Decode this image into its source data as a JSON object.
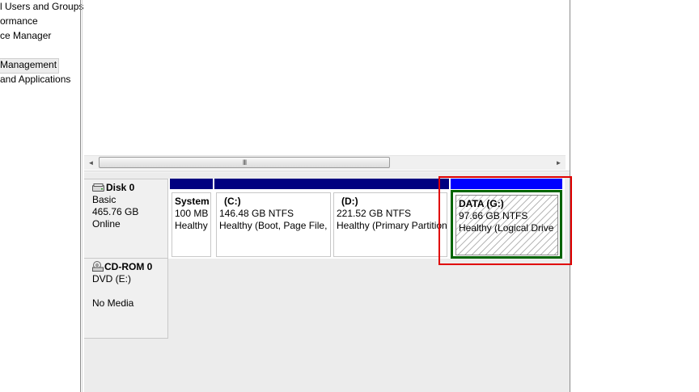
{
  "nav": {
    "items": [
      {
        "label": "l Users and Groups",
        "selected": false
      },
      {
        "label": "ormance",
        "selected": false
      },
      {
        "label": "ce Manager",
        "selected": false
      },
      {
        "label": "Management",
        "selected": true
      },
      {
        "label": "and Applications",
        "selected": false
      }
    ]
  },
  "scrollbar": {
    "left_arrow": "◄",
    "right_arrow": "►",
    "grip": "III"
  },
  "disks": [
    {
      "icon": "hard-disk-icon",
      "name": "Disk 0",
      "type": "Basic",
      "size": "465.76 GB",
      "status": "Online",
      "partitions": [
        {
          "name": "System",
          "size": "100 MB",
          "status": "Healthy",
          "kind": "primary"
        },
        {
          "name": "(C:)",
          "size": "146.48 GB NTFS",
          "status": "Healthy (Boot, Page File,",
          "kind": "primary"
        },
        {
          "name": "(D:)",
          "size": "221.52 GB NTFS",
          "status": "Healthy (Primary Partition",
          "kind": "primary"
        },
        {
          "name": "DATA  (G:)",
          "size": "97.66 GB NTFS",
          "status": "Healthy (Logical Drive",
          "kind": "logical"
        }
      ]
    },
    {
      "icon": "cd-rom-icon",
      "name": "CD-ROM 0",
      "type": "DVD (E:)",
      "size": "",
      "status": "No Media"
    }
  ],
  "colors": {
    "primary_partition": "#000080",
    "logical_drive": "#0000ff",
    "extended_partition": "#006400",
    "highlight": "#e00000"
  }
}
